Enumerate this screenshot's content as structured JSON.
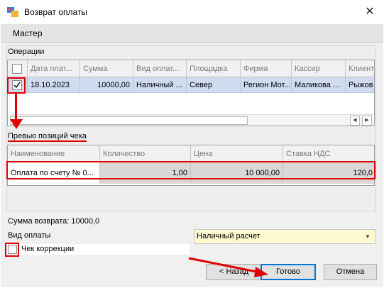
{
  "window": {
    "title": "Возврат оплаты",
    "close_glyph": "✕"
  },
  "wizard": {
    "step_title": "Мастер"
  },
  "operations": {
    "section_label": "Операции",
    "columns": [
      "Дата плат...",
      "Сумма",
      "Вид оплат...",
      "Площадка",
      "Фирма",
      "Кассир",
      "Клиент"
    ],
    "rows": [
      {
        "checked": true,
        "cells": [
          "18.10.2023",
          "10000,00",
          "Наличный ...",
          "Север",
          "Регион Мот...",
          "Маликова ...",
          "Рыжов"
        ]
      }
    ],
    "scroll_left_glyph": "◀",
    "scroll_right_glyph": "▶"
  },
  "preview": {
    "section_label": "Превью позиций чека",
    "columns": [
      "Наименование",
      "Количество",
      "Цена",
      "Ставка НДС"
    ],
    "rows": [
      {
        "cells": [
          "Оплата по счету № 0...",
          "1,00",
          "10 000,00",
          "120,0"
        ]
      }
    ]
  },
  "summary": {
    "refund_sum_label": "Сумма возврата: 10000,0"
  },
  "payment": {
    "label": "Вид оплаты",
    "selected": "Наличный расчет",
    "arrow_glyph": "▼"
  },
  "correction": {
    "label": "Чек коррекции",
    "checked": false
  },
  "buttons": {
    "back": "< Назад",
    "done": "Готово",
    "cancel": "Отмена"
  },
  "colors": {
    "annotation": "#e00000",
    "selected_row": "#cfdcf0",
    "combo_bg": "#fdfad0"
  },
  "icons": {
    "app": "app-window-icon",
    "checkmark": "checkmark-icon",
    "arrow": "red-arrow-icon"
  }
}
